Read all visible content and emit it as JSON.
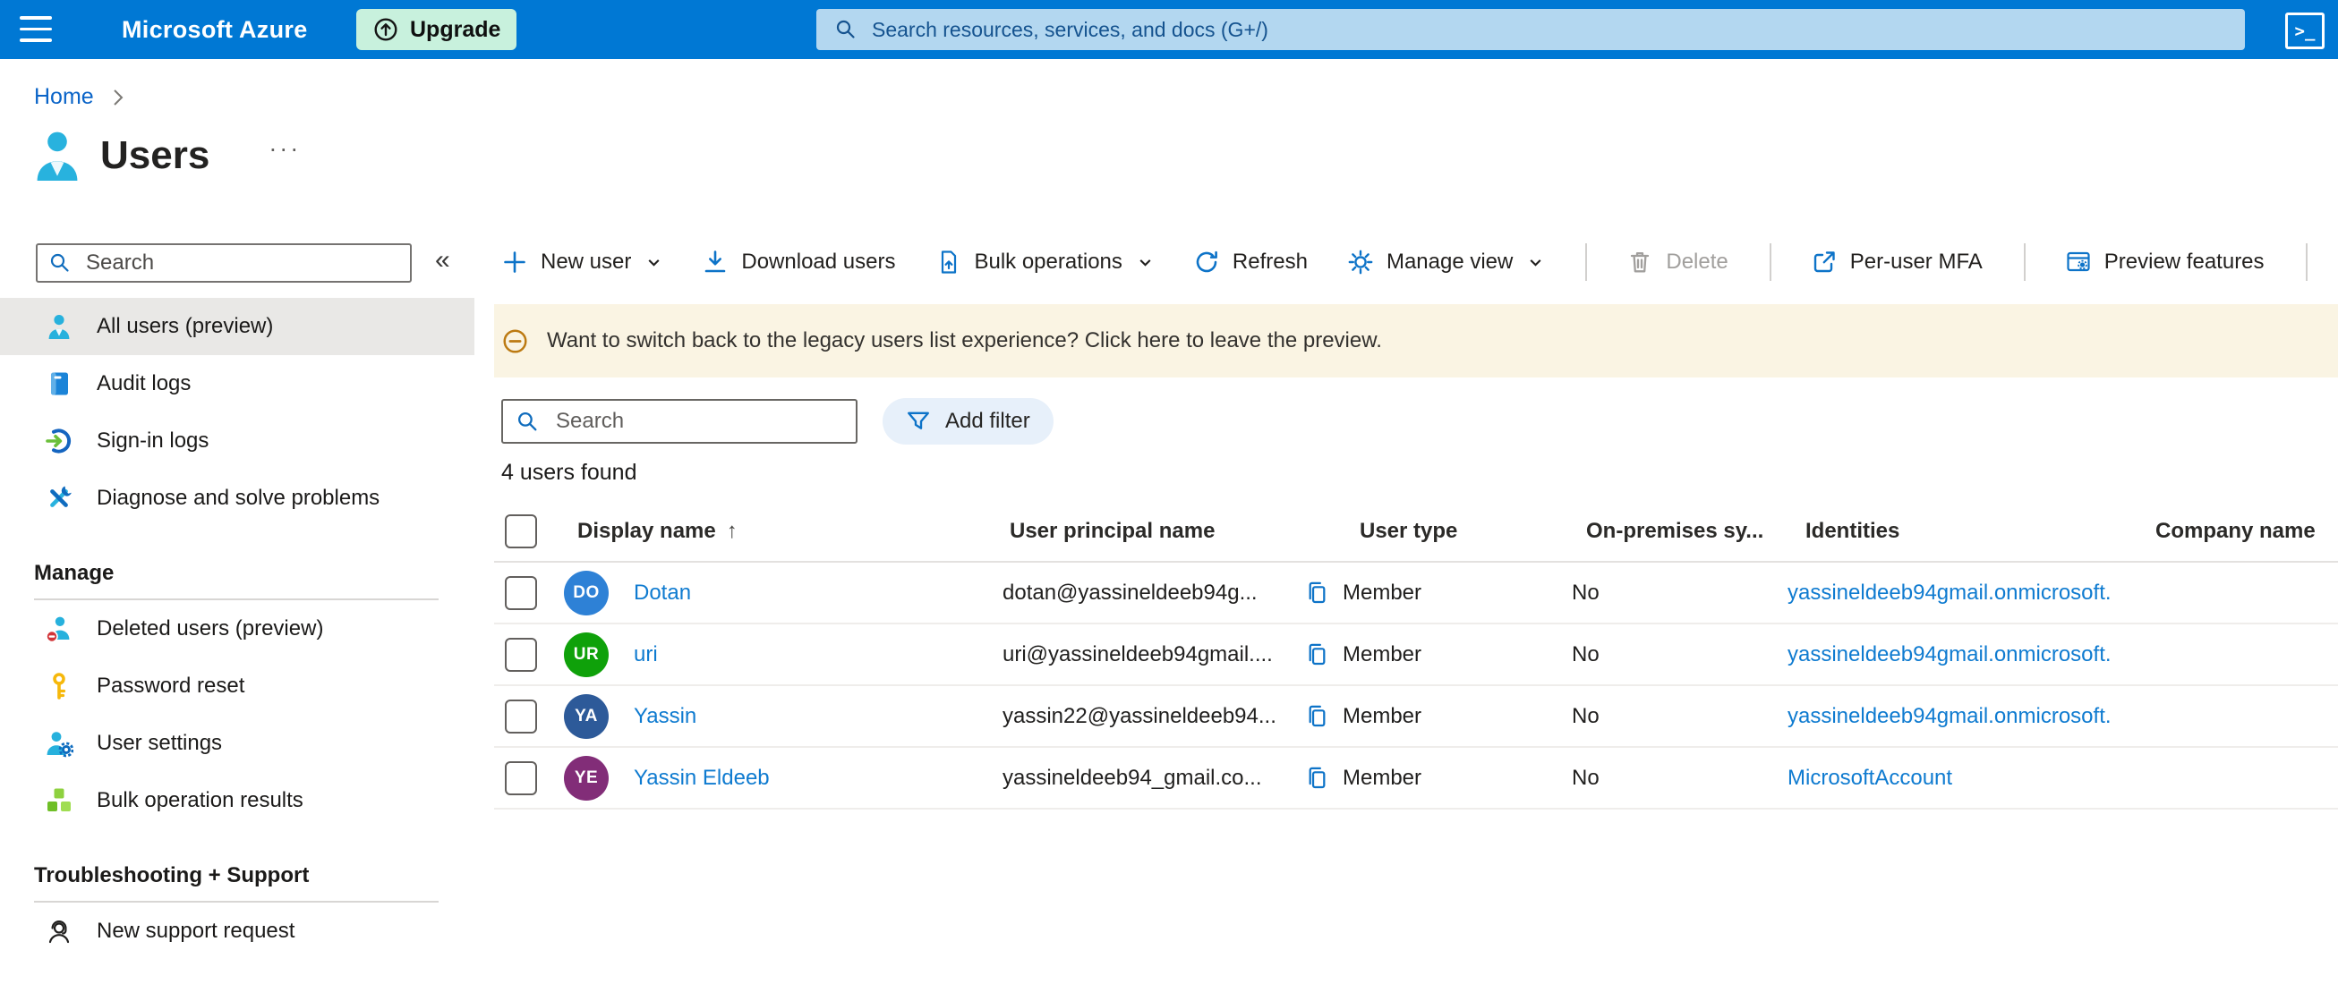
{
  "colors": {
    "topbar": "#0078d4",
    "topbar_search_bg": "#b3d7f0",
    "upgrade_bg": "#c8f1dd",
    "selected_nav_bg": "#e9e8e6",
    "banner_bg": "#faf4e3",
    "accent_blue": "#0d73c8",
    "link_blue": "#0f7bd0",
    "disabled_gray": "#a19f9d"
  },
  "topbar": {
    "brand": "Microsoft Azure",
    "upgrade_label": "Upgrade",
    "search_placeholder": "Search resources, services, and docs (G+/)",
    "shell_glyph": ">_"
  },
  "breadcrumb": {
    "home": "Home"
  },
  "page": {
    "title": "Users",
    "more_glyph": "···"
  },
  "sidebar": {
    "search_placeholder": "Search",
    "collapse_glyph": "«",
    "items_top": [
      {
        "label": "All users (preview)",
        "selected": true
      },
      {
        "label": "Audit logs"
      },
      {
        "label": "Sign-in logs"
      },
      {
        "label": "Diagnose and solve problems"
      }
    ],
    "sections": [
      {
        "header": "Manage",
        "items": [
          {
            "label": "Deleted users (preview)"
          },
          {
            "label": "Password reset"
          },
          {
            "label": "User settings"
          },
          {
            "label": "Bulk operation results"
          }
        ]
      },
      {
        "header": "Troubleshooting + Support",
        "items": [
          {
            "label": "New support request"
          }
        ]
      }
    ]
  },
  "toolbar": {
    "new_user": "New user",
    "download_users": "Download users",
    "bulk_operations": "Bulk operations",
    "refresh": "Refresh",
    "manage_view": "Manage view",
    "delete": "Delete",
    "per_user_mfa": "Per-user MFA",
    "preview_features": "Preview features"
  },
  "banner": {
    "text": "Want to switch back to the legacy users list experience? Click here to leave the preview."
  },
  "filters": {
    "search_placeholder": "Search",
    "add_filter_label": "Add filter"
  },
  "results": {
    "count_text": "4 users found"
  },
  "table": {
    "sort_glyph": "↑",
    "columns": [
      "Display name",
      "User principal name",
      "User type",
      "On-premises sy...",
      "Identities",
      "Company name"
    ],
    "rows": [
      {
        "initials": "DO",
        "avatar_color": "#2e81d6",
        "display_name": "Dotan",
        "upn": "dotan@yassineldeeb94g...",
        "user_type": "Member",
        "on_premises": "No",
        "identities": "yassineldeeb94gmail.onmicrosoft.",
        "company": ""
      },
      {
        "initials": "UR",
        "avatar_color": "#0fa10a",
        "display_name": "uri",
        "upn": "uri@yassineldeeb94gmail....",
        "user_type": "Member",
        "on_premises": "No",
        "identities": "yassineldeeb94gmail.onmicrosoft.",
        "company": ""
      },
      {
        "initials": "YA",
        "avatar_color": "#2d5a99",
        "display_name": "Yassin",
        "upn": "yassin22@yassineldeeb94...",
        "user_type": "Member",
        "on_premises": "No",
        "identities": "yassineldeeb94gmail.onmicrosoft.",
        "company": ""
      },
      {
        "initials": "YE",
        "avatar_color": "#822d78",
        "display_name": "Yassin Eldeeb",
        "upn": "yassineldeeb94_gmail.co...",
        "user_type": "Member",
        "on_premises": "No",
        "identities": "MicrosoftAccount",
        "company": ""
      }
    ]
  }
}
